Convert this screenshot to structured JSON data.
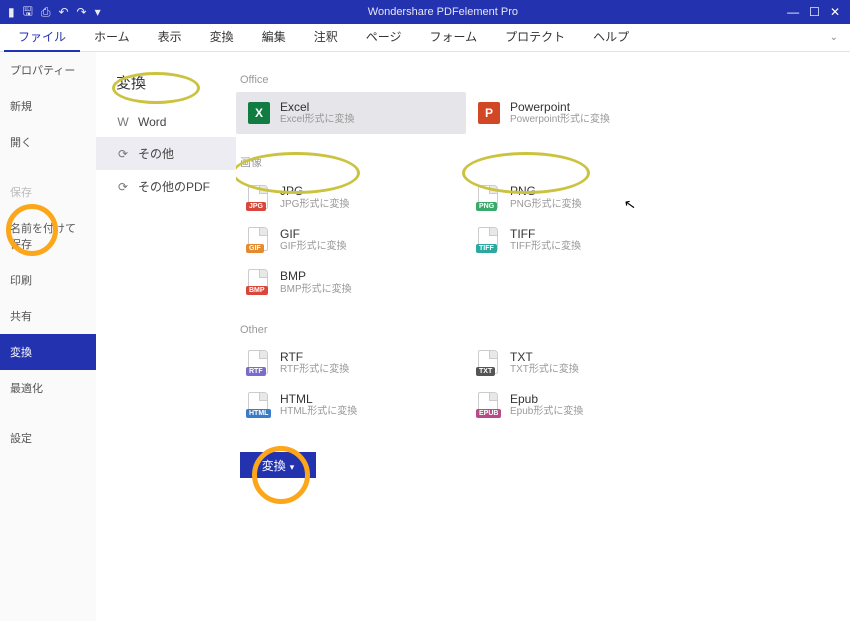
{
  "app": {
    "title": "Wondershare PDFelement Pro"
  },
  "menubar": {
    "items": [
      "ファイル",
      "ホーム",
      "表示",
      "変換",
      "編集",
      "注釈",
      "ページ",
      "フォーム",
      "プロテクト",
      "ヘルプ"
    ],
    "active": 0
  },
  "sidebar": {
    "items": [
      {
        "label": "プロパティー"
      },
      {
        "label": "新規"
      },
      {
        "label": "開く"
      },
      {
        "label": "保存",
        "disabled": true
      },
      {
        "label": "名前を付けて保存"
      },
      {
        "label": "印刷"
      },
      {
        "label": "共有"
      },
      {
        "label": "変換",
        "selected": true
      },
      {
        "label": "最適化"
      },
      {
        "label": "設定"
      }
    ]
  },
  "mid": {
    "title": "変換",
    "items": [
      {
        "icon": "W",
        "label": "Word"
      },
      {
        "icon": "⟳",
        "label": "その他",
        "selected": true
      },
      {
        "icon": "⟳",
        "label": "その他のPDF"
      }
    ]
  },
  "content": {
    "sections": [
      {
        "title": "Office",
        "tiles": [
          {
            "tag": "XLS",
            "name": "Excel",
            "desc": "Excel形式に変換",
            "cls": "xls",
            "selected": true
          },
          {
            "tag": "PPT",
            "name": "Powerpoint",
            "desc": "Powerpoint形式に変換",
            "cls": "ppt"
          }
        ]
      },
      {
        "title": "画像",
        "tiles": [
          {
            "tag": "JPG",
            "name": "JPG",
            "desc": "JPG形式に変換",
            "cls": "jpg"
          },
          {
            "tag": "PNG",
            "name": "PNG",
            "desc": "PNG形式に変換",
            "cls": "png"
          },
          {
            "tag": "GIF",
            "name": "GIF",
            "desc": "GIF形式に変換",
            "cls": "gif"
          },
          {
            "tag": "TIFF",
            "name": "TIFF",
            "desc": "TIFF形式に変換",
            "cls": "tiff"
          },
          {
            "tag": "BMP",
            "name": "BMP",
            "desc": "BMP形式に変換",
            "cls": "bmp"
          }
        ]
      },
      {
        "title": "Other",
        "tiles": [
          {
            "tag": "RTF",
            "name": "RTF",
            "desc": "RTF形式に変換",
            "cls": "rtf"
          },
          {
            "tag": "TXT",
            "name": "TXT",
            "desc": "TXT形式に変換",
            "cls": "txt"
          },
          {
            "tag": "HTML",
            "name": "HTML",
            "desc": "HTML形式に変換",
            "cls": "html"
          },
          {
            "tag": "EPUB",
            "name": "Epub",
            "desc": "Epub形式に変換",
            "cls": "epub"
          }
        ]
      }
    ],
    "convert_button": "変換"
  }
}
